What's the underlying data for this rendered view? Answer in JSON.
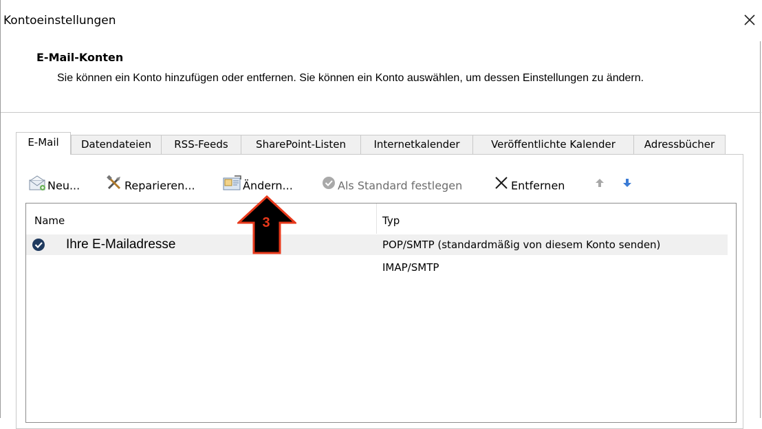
{
  "window": {
    "title": "Kontoeinstellungen",
    "close_icon": "close-icon"
  },
  "header": {
    "title": "E-Mail-Konten",
    "description": "Sie können ein Konto hinzufügen oder entfernen. Sie können ein Konto auswählen, um dessen Einstellungen zu ändern."
  },
  "tabs": [
    {
      "label": "E-Mail",
      "active": true
    },
    {
      "label": "Datendateien"
    },
    {
      "label": "RSS-Feeds"
    },
    {
      "label": "SharePoint-Listen"
    },
    {
      "label": "Internetkalender"
    },
    {
      "label": "Veröffentlichte Kalender"
    },
    {
      "label": "Adressbücher"
    }
  ],
  "toolbar": {
    "new_label": "Neu...",
    "repair_label": "Reparieren...",
    "change_label": "Ändern...",
    "default_label": "Als Standard festlegen",
    "remove_label": "Entfernen",
    "icons": [
      "new-mail-icon",
      "repair-tools-icon",
      "change-account-icon",
      "default-check-icon",
      "remove-x-icon",
      "move-up-icon",
      "move-down-icon"
    ]
  },
  "list": {
    "columns": [
      "Name",
      "Typ"
    ],
    "rows": [
      {
        "name": "Ihre E-Mailadresse",
        "type": "POP/SMTP (standardmäßig von diesem Konto senden)",
        "is_default": true
      },
      {
        "name": "",
        "type": "IMAP/SMTP",
        "is_default": false
      }
    ]
  },
  "annotation": {
    "step_number": "3",
    "arrow_color": "#000000",
    "number_color": "#e8391b"
  },
  "colors": {
    "accent_blue": "#3b7bd5",
    "default_badge": "#1f3a5f",
    "selection_bg": "#f0f0f0"
  }
}
